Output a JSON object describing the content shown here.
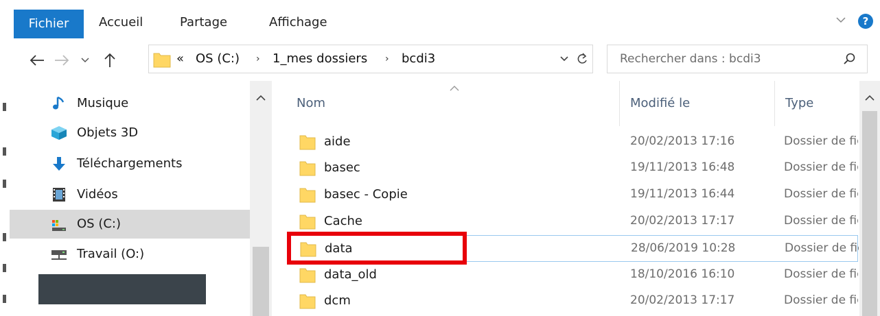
{
  "ribbon": {
    "tabs": [
      {
        "label": "Fichier"
      },
      {
        "label": "Accueil"
      },
      {
        "label": "Partage"
      },
      {
        "label": "Affichage"
      }
    ],
    "help_label": "?"
  },
  "address": {
    "overflow": "«",
    "crumbs": [
      "OS (C:)",
      "1_mes dossiers",
      "bcdi3"
    ],
    "separator": "›"
  },
  "search": {
    "placeholder": "Rechercher dans : bcdi3"
  },
  "nav": {
    "items": [
      {
        "label": "Musique",
        "icon": "music-icon"
      },
      {
        "label": "Objets 3D",
        "icon": "objects-3d-icon"
      },
      {
        "label": "Téléchargements",
        "icon": "download-icon"
      },
      {
        "label": "Vidéos",
        "icon": "video-icon"
      },
      {
        "label": "OS (C:)",
        "icon": "drive-icon",
        "selected": true
      },
      {
        "label": "Travail (O:)",
        "icon": "network-drive-icon"
      }
    ]
  },
  "columns": {
    "name": "Nom",
    "modified": "Modifié le",
    "type": "Type"
  },
  "files": [
    {
      "name": "aide",
      "modified": "20/02/2013 17:16",
      "type": "Dossier de fichiers"
    },
    {
      "name": "basec",
      "modified": "19/11/2013 16:48",
      "type": "Dossier de fichiers"
    },
    {
      "name": "basec - Copie",
      "modified": "19/11/2013 16:44",
      "type": "Dossier de fichiers"
    },
    {
      "name": "Cache",
      "modified": "20/02/2013 17:17",
      "type": "Dossier de fichiers"
    },
    {
      "name": "data",
      "modified": "28/06/2019 10:28",
      "type": "Dossier de fichiers",
      "focused": true
    },
    {
      "name": "data_old",
      "modified": "18/10/2016 16:10",
      "type": "Dossier de fichiers"
    },
    {
      "name": "dcm",
      "modified": "20/02/2013 17:17",
      "type": "Dossier de fichiers"
    }
  ],
  "colors": {
    "accent": "#1979ca",
    "highlight": "#e8000a",
    "folder": "#ffd764"
  }
}
